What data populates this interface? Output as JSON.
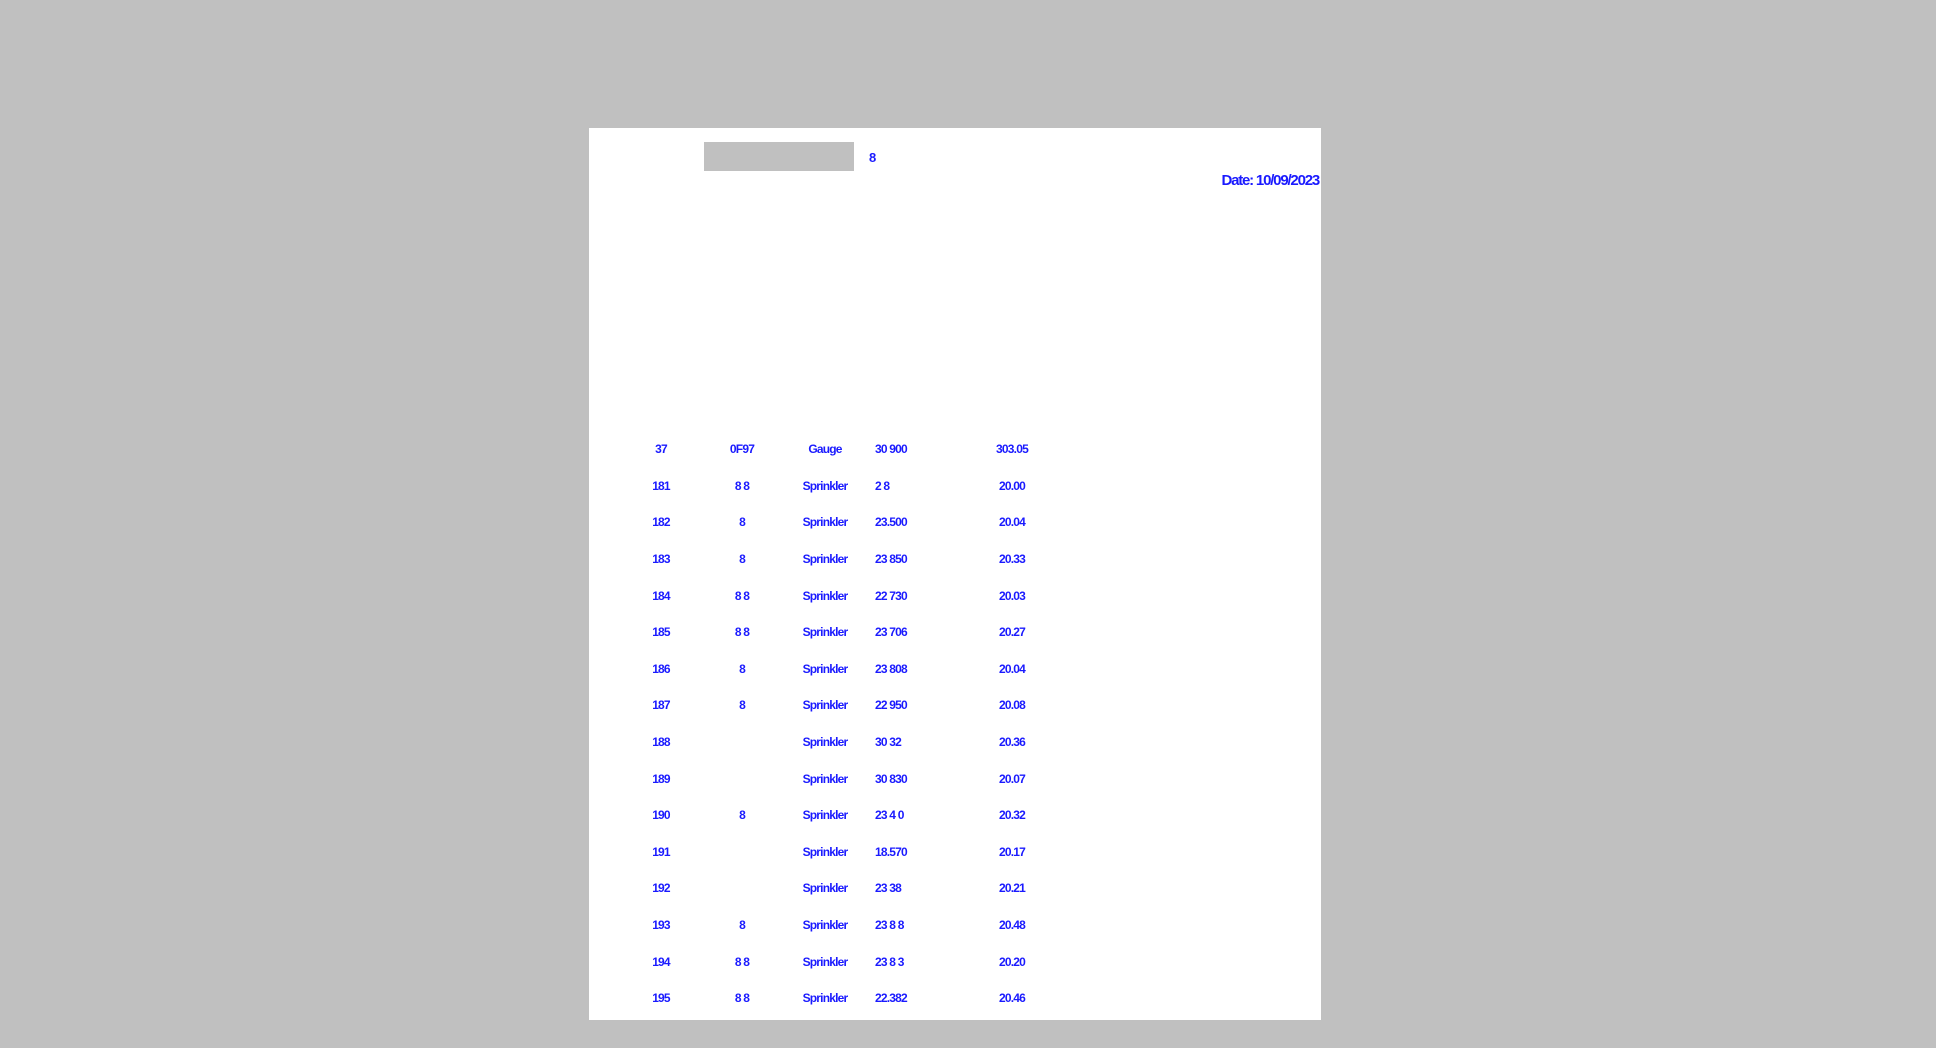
{
  "header": {
    "field_value": "",
    "mark": "8",
    "date_label": "Date:",
    "date_value": "10/09/2023"
  },
  "table": {
    "rows": [
      {
        "id": "37",
        "code": "0F97",
        "type": "Gauge",
        "reading": "30 900",
        "value": "303.05"
      },
      {
        "id": "181",
        "code": "8 8",
        "type": "Sprinkler",
        "reading": "2   8",
        "value": "20.00"
      },
      {
        "id": "182",
        "code": "8",
        "type": "Sprinkler",
        "reading": "23.500",
        "value": "20.04"
      },
      {
        "id": "183",
        "code": "8",
        "type": "Sprinkler",
        "reading": "23 850",
        "value": "20.33"
      },
      {
        "id": "184",
        "code": "8 8",
        "type": "Sprinkler",
        "reading": "22 730",
        "value": "20.03"
      },
      {
        "id": "185",
        "code": "8 8",
        "type": "Sprinkler",
        "reading": "23 706",
        "value": "20.27"
      },
      {
        "id": "186",
        "code": "8",
        "type": "Sprinkler",
        "reading": "23 808",
        "value": "20.04"
      },
      {
        "id": "187",
        "code": "8",
        "type": "Sprinkler",
        "reading": "22 950",
        "value": "20.08"
      },
      {
        "id": "188",
        "code": "",
        "type": "Sprinkler",
        "reading": "30 32",
        "value": "20.36"
      },
      {
        "id": "189",
        "code": "",
        "type": "Sprinkler",
        "reading": "30 830",
        "value": "20.07"
      },
      {
        "id": "190",
        "code": "8",
        "type": "Sprinkler",
        "reading": "23 4  0",
        "value": "20.32"
      },
      {
        "id": "191",
        "code": "",
        "type": "Sprinkler",
        "reading": "18.570",
        "value": "20.17"
      },
      {
        "id": "192",
        "code": "",
        "type": "Sprinkler",
        "reading": "23   38",
        "value": "20.21"
      },
      {
        "id": "193",
        "code": "8",
        "type": "Sprinkler",
        "reading": "23 8  8",
        "value": "20.48"
      },
      {
        "id": "194",
        "code": "8 8",
        "type": "Sprinkler",
        "reading": "23 8  3",
        "value": "20.20"
      },
      {
        "id": "195",
        "code": "8 8",
        "type": "Sprinkler",
        "reading": "22.382",
        "value": "20.46"
      }
    ]
  }
}
